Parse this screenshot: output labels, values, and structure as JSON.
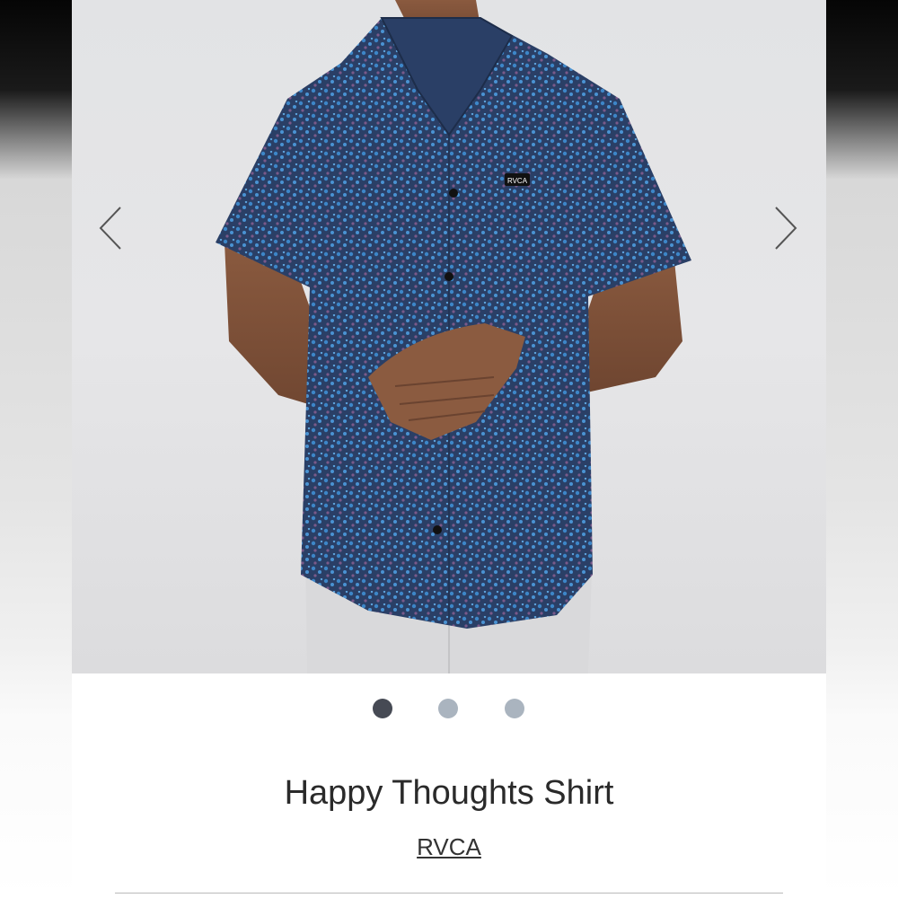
{
  "product": {
    "title": "Happy Thoughts Shirt",
    "brand": "RVCA",
    "shirt_label": "RVCA"
  },
  "carousel": {
    "image_count": 3,
    "active_index": 0,
    "prev_icon": "chevron-left-icon",
    "next_icon": "chevron-right-icon"
  },
  "colors": {
    "dot_active": "#464a54",
    "dot_inactive": "#aab4bf",
    "arrow": "#555555",
    "shirt": "#2c4670",
    "pattern": "#3f86c9"
  }
}
